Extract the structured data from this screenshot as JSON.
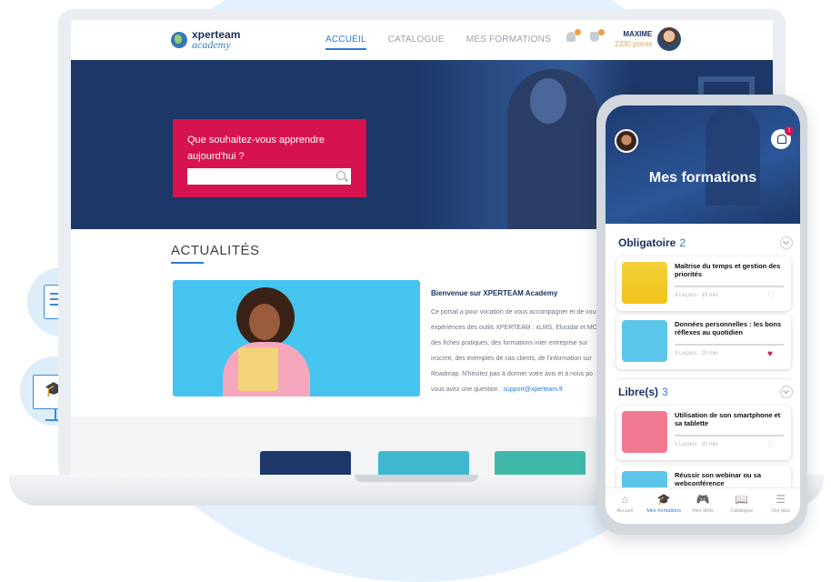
{
  "desktop": {
    "logo": {
      "line1": "xperteam",
      "line2": "academy"
    },
    "nav": [
      "ACCUEIL",
      "CATALOGUE",
      "MES FORMATIONS"
    ],
    "user": {
      "name": "MAXIME",
      "points": "2330 points"
    },
    "search": {
      "question": "Que souhaitez-vous apprendre aujourd'hui ?",
      "placeholder": ""
    },
    "news": {
      "heading": "ACTUALITÉS",
      "title": "Bienvenue sur XPERTEAM Academy",
      "lines": [
        "Ce portail a pour vocation de vous accompagner et de vous",
        "expériences des outils XPERTEAM : xLMS, Elucidat et MO",
        "des fiches pratiques, des formations inter entreprise sur",
        "inscrire, des exemples de cas clients, de l'information sur",
        "Roadmap. N'hésitez pas à donner votre avis et à nous po"
      ],
      "contact_prefix": "vous avez une question : ",
      "contact_email": "support@xperteam.fr"
    },
    "colors": {
      "accent": "#2a7bd6",
      "brand": "#d6134f",
      "navy": "#1d3768"
    }
  },
  "mobile": {
    "title": "Mes formations",
    "notification_count": "1",
    "sections": [
      {
        "label": "Obligatoire",
        "count": "2"
      },
      {
        "label": "Libre(s)",
        "count": "3"
      }
    ],
    "courses": [
      {
        "title": "Maîtrise du temps et gestion des priorités",
        "meta": "3 Leçons · 15 min",
        "liked": false,
        "thumb": "hourglass"
      },
      {
        "title": "Données personnelles : les bons réflexes au quotidien",
        "meta": "3 Leçons · 20 min",
        "liked": true,
        "thumb": "headphones-desk"
      },
      {
        "title": "Utilisation de son smartphone et sa tablette",
        "meta": "1 Leçons · 20 min",
        "liked": false,
        "thumb": "woman-phone"
      },
      {
        "title": "Réussir son webinar ou sa webconférence",
        "meta": "",
        "liked": false,
        "thumb": "webinar"
      }
    ],
    "tabs": [
      {
        "label": "Accueil",
        "icon": "home-icon"
      },
      {
        "label": "Mes formations",
        "icon": "graduation-cap-icon",
        "active": true
      },
      {
        "label": "Mes défis",
        "icon": "gamepad-icon"
      },
      {
        "label": "Catalogue",
        "icon": "book-icon"
      },
      {
        "label": "Voir plus",
        "icon": "menu-icon"
      }
    ]
  }
}
